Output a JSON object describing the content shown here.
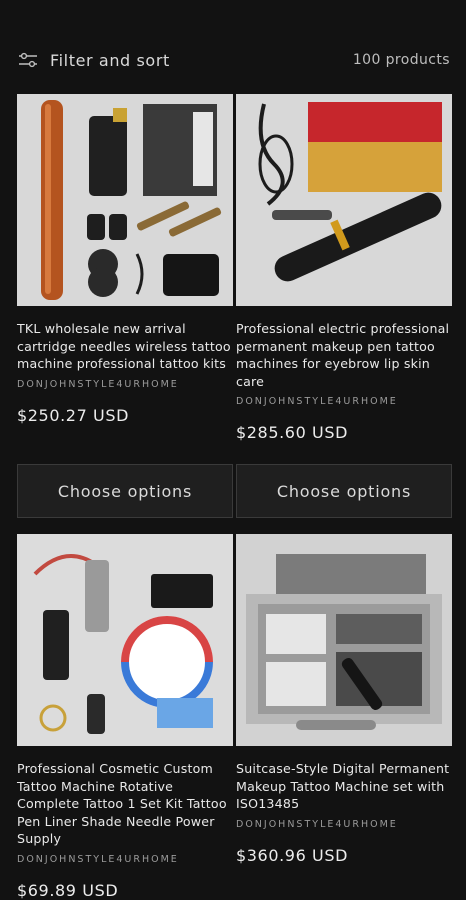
{
  "toolbar": {
    "filter_label": "Filter and sort",
    "product_count": "100 products"
  },
  "products": [
    {
      "title": "TKL wholesale new arrival cartridge needles wireless tattoo machine professional tattoo kits",
      "vendor": "DONJOHNSTYLE4URHOME",
      "price": "$250.27 USD",
      "button": "Choose options"
    },
    {
      "title": "Professional electric professional permanent makeup pen tattoo machines for eyebrow lip skin care",
      "vendor": "DONJOHNSTYLE4URHOME",
      "price": "$285.60 USD",
      "button": "Choose options"
    },
    {
      "title": "Professional Cosmetic Custom Tattoo Machine Rotative Complete Tattoo 1 Set Kit Tattoo Pen Liner Shade Needle Power Supply",
      "vendor": "DONJOHNSTYLE4URHOME",
      "price": "$69.89 USD"
    },
    {
      "title": "Suitcase-Style Digital Permanent Makeup Tattoo Machine set with ISO13485",
      "vendor": "DONJOHNSTYLE4URHOME",
      "price": "$360.96 USD"
    }
  ]
}
